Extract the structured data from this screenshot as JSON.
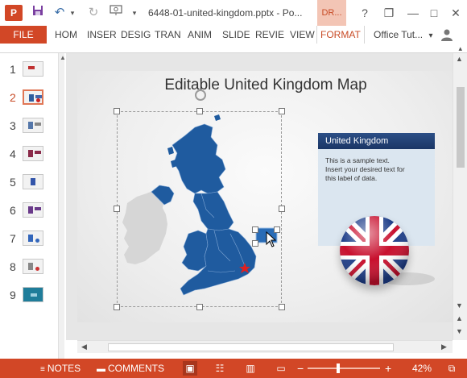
{
  "titlebar": {
    "app_icon": "P",
    "doc_title": "6448-01-united-kingdom.pptx - Po...",
    "context_tab": "DR...",
    "icons": [
      "save-icon",
      "undo-icon",
      "redo-icon",
      "start-from-beginning-icon",
      "customize-icon"
    ],
    "help": "?",
    "restore": "❐",
    "minimize": "—",
    "maximize": "□",
    "close": "✕"
  },
  "ribbon": {
    "file": "FILE",
    "tabs": [
      "HOM",
      "INSER",
      "DESIG",
      "TRAN",
      "ANIM",
      "SLIDE",
      "REVIE",
      "VIEW",
      "FORMAT"
    ],
    "active_tab": "FORMAT",
    "account": "Office Tut...",
    "account_caret": "▾"
  },
  "thumbnails": {
    "items": [
      {
        "num": "1",
        "active": false
      },
      {
        "num": "2",
        "active": true
      },
      {
        "num": "3",
        "active": false
      },
      {
        "num": "4",
        "active": false
      },
      {
        "num": "5",
        "active": false
      },
      {
        "num": "6",
        "active": false
      },
      {
        "num": "7",
        "active": false
      },
      {
        "num": "8",
        "active": false
      },
      {
        "num": "9",
        "active": false
      }
    ]
  },
  "slide": {
    "title": "Editable United Kingdom Map",
    "label_title": "United Kingdom",
    "label_text": "This is a sample text. Insert your desired text for this label of data."
  },
  "colors": {
    "accent": "#d24726",
    "map_blue": "#1f5b9f",
    "ireland_grey": "#d6d6d6",
    "marker_red": "#e02020"
  },
  "statusbar": {
    "notes": "NOTES",
    "comments": "COMMENTS",
    "zoom_minus": "−",
    "zoom_plus": "+",
    "zoom_level": "42%",
    "zoom_fraction": 0.42
  }
}
